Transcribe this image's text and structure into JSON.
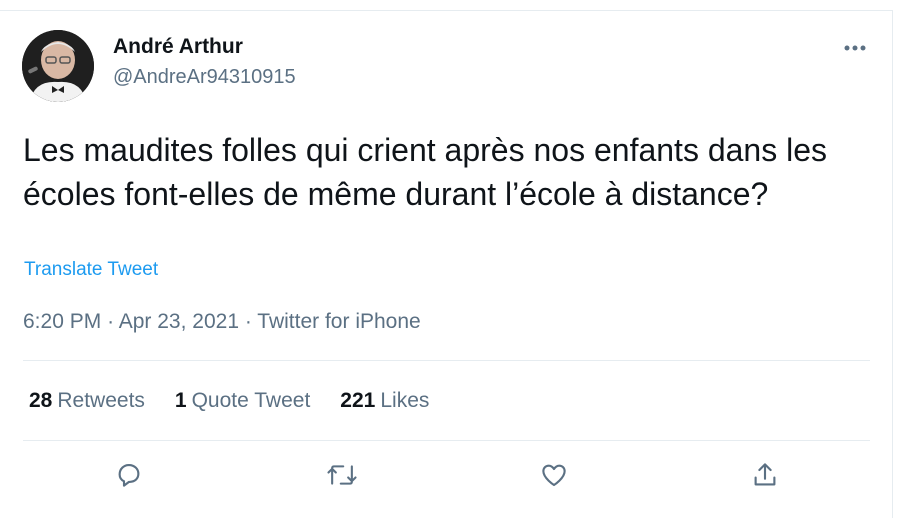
{
  "author": {
    "name": "André Arthur",
    "handle": "@AndreAr94310915",
    "avatar_icon": "avatar-photo"
  },
  "tweet": {
    "text": "Les maudites folles qui crient après nos enfants dans les écoles font-elles de même durant l’école à distance?",
    "translate_label": "Translate Tweet",
    "time": "6:20 PM",
    "date": "Apr 23, 2021",
    "source": "Twitter for iPhone",
    "separator": "·"
  },
  "stats": {
    "retweets_count": "28",
    "retweets_label": "Retweets",
    "quotes_count": "1",
    "quotes_label": "Quote Tweet",
    "likes_count": "221",
    "likes_label": "Likes"
  },
  "actions": {
    "reply_icon": "reply-icon",
    "retweet_icon": "retweet-icon",
    "like_icon": "heart-icon",
    "share_icon": "share-icon",
    "more_icon": "more-icon"
  },
  "colors": {
    "text": "#0f1419",
    "secondary": "#5b7083",
    "link": "#1d9bf0",
    "divider": "#e6ecf0"
  }
}
